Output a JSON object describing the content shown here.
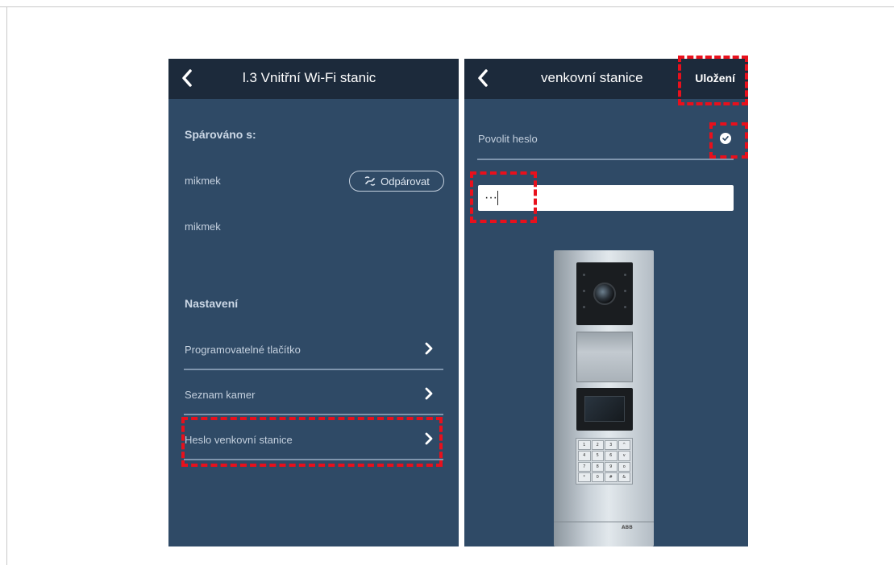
{
  "left_screen": {
    "title": "l.3 Vnitřní Wi-Fi stanic",
    "paired_heading": "Spárováno s:",
    "paired_devices": [
      "mikmek",
      "mikmek"
    ],
    "unpair_label": "Odpárovat",
    "settings_heading": "Nastavení",
    "settings_items": [
      "Programovatelné tlačítko",
      "Seznam kamer",
      "Heslo venkovní stanice"
    ]
  },
  "right_screen": {
    "title": "venkovní stanice",
    "save_label": "Uložení",
    "enable_password_label": "Povolit heslo",
    "enable_password_checked": true,
    "password_value": "···"
  },
  "door_station": {
    "keypad_keys": [
      "1",
      "2",
      "3",
      "^",
      "4",
      "5",
      "6",
      "v",
      "7",
      "8",
      "9",
      "o",
      "*",
      "0",
      "#",
      "&"
    ],
    "logo": "ABB"
  },
  "colors": {
    "app_background": "#2f4a66",
    "topbar": "#1c2a3b",
    "highlight": "#e8101c"
  }
}
